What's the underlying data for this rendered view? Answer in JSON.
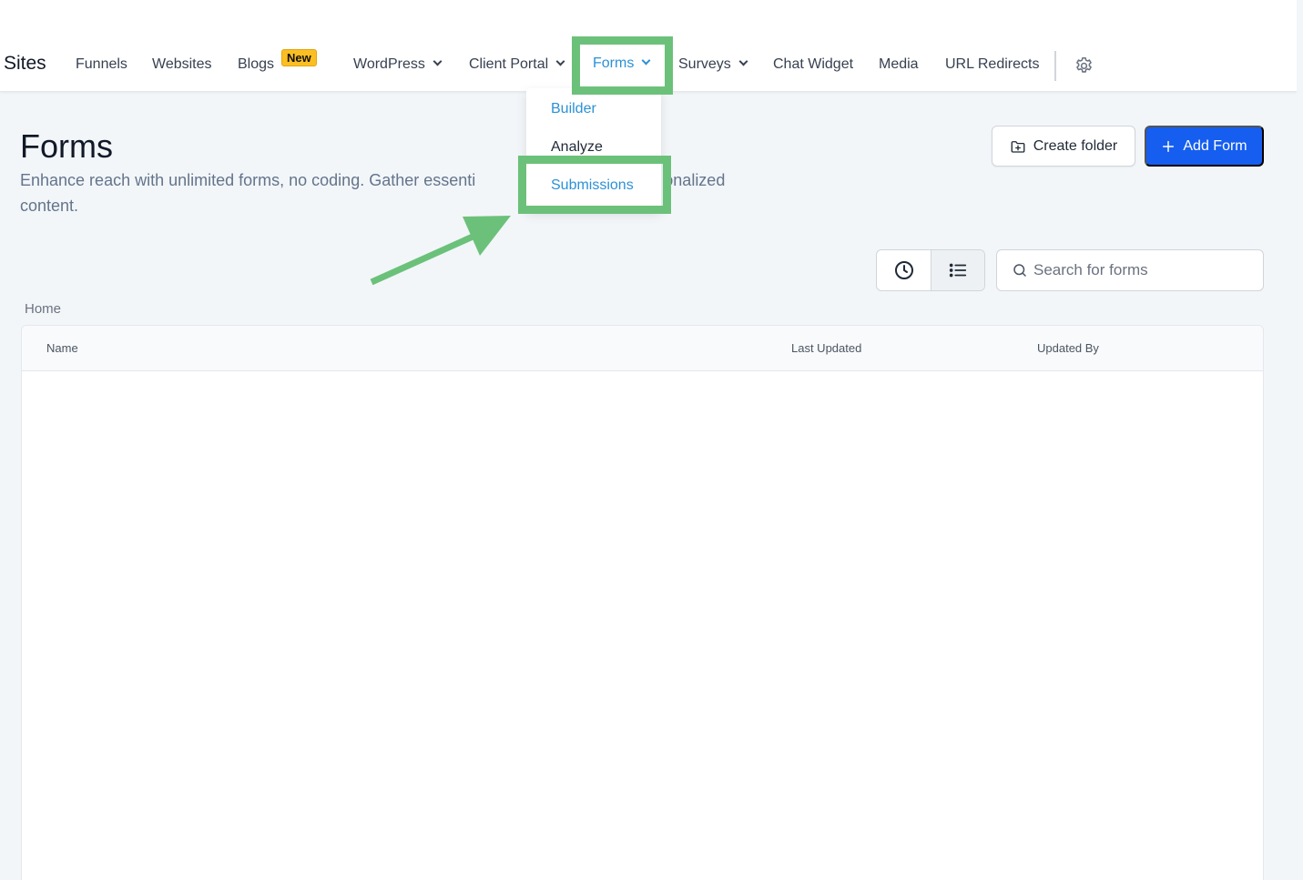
{
  "nav": {
    "brand": "Sites",
    "items": [
      "Funnels",
      "Websites",
      "Blogs",
      "WordPress",
      "Client Portal",
      "Forms",
      "Surveys",
      "Chat Widget",
      "Media",
      "URL Redirects"
    ],
    "new_badge": "New",
    "active": "Forms"
  },
  "dropdown": {
    "items": [
      "Builder",
      "Analyze",
      "Submissions"
    ]
  },
  "header": {
    "title": "Forms",
    "description_visible_line1_left": "Enhance reach with unlimited forms, no coding. Gather essenti",
    "description_visible_line1_right": "personalized",
    "description_line2": "content."
  },
  "actions": {
    "create_folder": "Create folder",
    "add_form": "Add Form"
  },
  "search": {
    "placeholder": "Search for forms"
  },
  "breadcrumb": "Home",
  "table": {
    "columns": [
      "Name",
      "Last Updated",
      "Updated By"
    ]
  },
  "colors": {
    "accent": "#155eef",
    "active_link": "#2b91d6",
    "highlight": "#6cc17a",
    "badge": "#fbbf24"
  }
}
